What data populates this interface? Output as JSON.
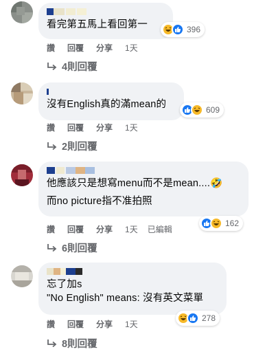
{
  "comments": [
    {
      "text_lines": [
        "看完第五馬上看回第一"
      ],
      "reactions": {
        "icons": [
          "haha-emoji",
          "like-thumb"
        ],
        "count": "396"
      },
      "actions": {
        "like": "讚",
        "reply": "回覆",
        "share": "分享",
        "time": "1天",
        "edited": ""
      },
      "replies_label": "4則回覆"
    },
    {
      "text_lines": [
        "沒有English真的滿mean的"
      ],
      "reactions": {
        "icons": [
          "like-thumb",
          "haha-emoji"
        ],
        "count": "609"
      },
      "actions": {
        "like": "讚",
        "reply": "回覆",
        "share": "分享",
        "time": "1天",
        "edited": ""
      },
      "replies_label": "2則回覆"
    },
    {
      "text_lines": [
        "他應該只是想寫menu而不是mean....🤣",
        "而no picture指不准拍照"
      ],
      "reactions": {
        "icons": [
          "like-thumb",
          "haha-emoji"
        ],
        "count": "162"
      },
      "actions": {
        "like": "讚",
        "reply": "回覆",
        "share": "分享",
        "time": "1天",
        "edited": "已編輯"
      },
      "replies_label": "6則回覆"
    },
    {
      "text_lines": [
        "忘了加s",
        "\"No English\" means: 沒有英文菜單"
      ],
      "reactions": {
        "icons": [
          "haha-emoji",
          "like-thumb"
        ],
        "count": "278"
      },
      "actions": {
        "like": "讚",
        "reply": "回覆",
        "share": "分享",
        "time": "1天",
        "edited": ""
      },
      "replies_label": "8則回覆"
    }
  ],
  "colors": {
    "bubble": "#f0f2f5",
    "meta_text": "#65676b",
    "like_blue": "#1877f2",
    "haha_yellow": "#f7b928"
  }
}
